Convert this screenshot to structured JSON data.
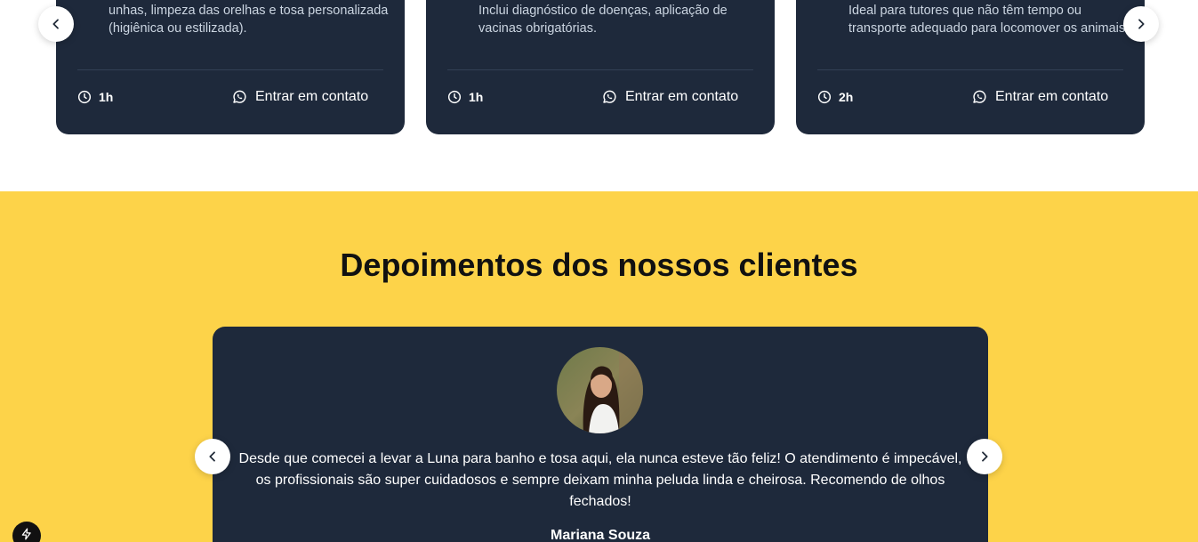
{
  "services": {
    "cards": [
      {
        "description": "unhas, limpeza das orelhas e tosa personalizada (higiênica ou estilizada).",
        "duration": "1h",
        "contact_label": "Entrar em contato"
      },
      {
        "description": "Inclui diagnóstico de doenças, aplicação de vacinas obrigatórias.",
        "duration": "1h",
        "contact_label": "Entrar em contato"
      },
      {
        "description": "Ideal para tutores que não têm tempo ou transporte adequado para locomover os animais.",
        "duration": "2h",
        "contact_label": "Entrar em contato"
      }
    ]
  },
  "testimonials": {
    "title": "Depoimentos dos nossos clientes",
    "quote": "Desde que comecei a levar a Luna para banho e tosa aqui, ela nunca esteve tão feliz! O atendimento é impecável, os profissionais são super cuidadosos e sempre deixam minha peluda linda e cheirosa. Recomendo de olhos fechados!",
    "author": "Mariana Souza"
  },
  "colors": {
    "card_bg": "#1e293b",
    "section_yellow": "#fdd349"
  },
  "icons": [
    "chevron-left-icon",
    "chevron-right-icon",
    "clock-icon",
    "whatsapp-icon",
    "lightning-icon"
  ]
}
